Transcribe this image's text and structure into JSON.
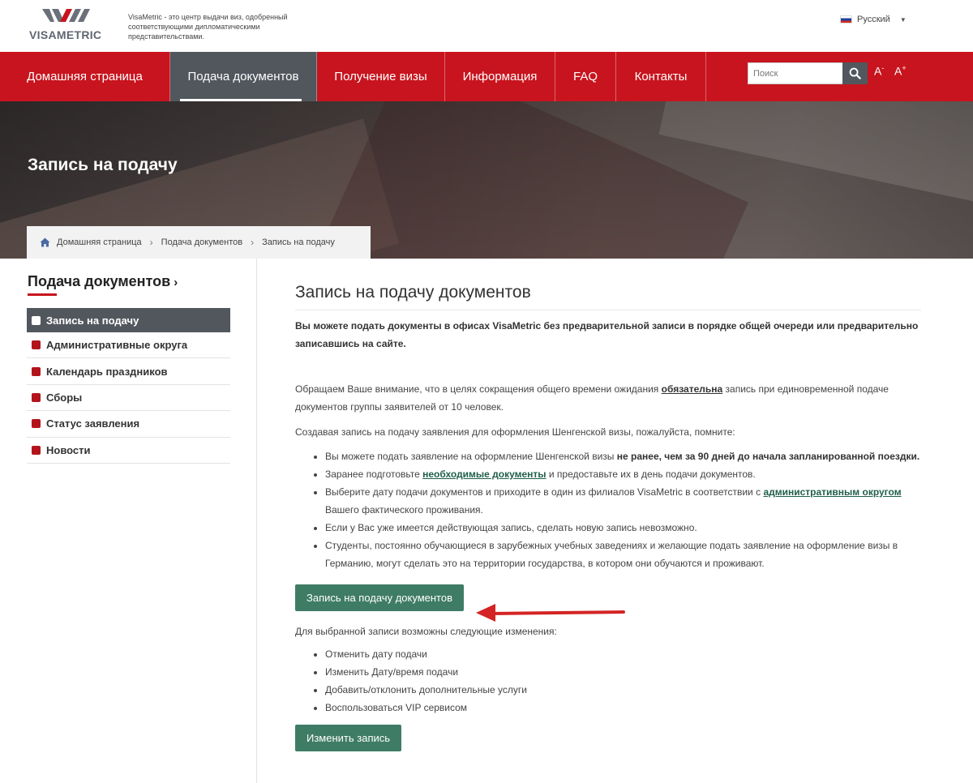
{
  "header": {
    "logo_text": "VISAMETRIC",
    "tagline": "VisaMetric - это центр выдачи виз, одобренный соответствующими дипломатическими представительствами.",
    "language": "Русский",
    "brand_color": "#c8141e"
  },
  "nav": {
    "items": [
      {
        "label": "Домашняя страница",
        "active": false
      },
      {
        "label": "Подача документов",
        "active": true
      },
      {
        "label": "Получение визы",
        "active": false
      },
      {
        "label": "Информация",
        "active": false
      },
      {
        "label": "FAQ",
        "active": false
      },
      {
        "label": "Контакты",
        "active": false
      }
    ],
    "search_placeholder": "Поиск",
    "font_decrease": "A",
    "font_decrease_sign": "-",
    "font_increase": "A",
    "font_increase_sign": "+"
  },
  "hero": {
    "title": "Запись на подачу",
    "breadcrumb": [
      "Домашняя страница",
      "Подача документов",
      "Запись на подачу"
    ]
  },
  "sidebar": {
    "title": "Подача документов",
    "title_chevron": "›",
    "items": [
      {
        "label": "Запись на подачу",
        "active": true
      },
      {
        "label": "Административные округа",
        "active": false
      },
      {
        "label": "Календарь праздников",
        "active": false
      },
      {
        "label": "Сборы",
        "active": false
      },
      {
        "label": "Статус заявления",
        "active": false
      },
      {
        "label": "Новости",
        "active": false
      }
    ]
  },
  "main": {
    "title": "Запись на подачу документов",
    "lead": "Вы можете подать документы в офисах VisaMetric без предварительной записи в порядке общей очереди или предварительно записавшись на сайте.",
    "p1": {
      "before": "Обращаем Ваше внимание, что в целях сокращения общего времени ожидания ",
      "bold": "обязательна",
      "after": " запись при единовременной подаче документов группы заявителей от 10 человек."
    },
    "p2": "Создавая запись на подачу заявления для оформления Шенгенской визы, пожалуйста, помните:",
    "bullets": {
      "b1_text": "Вы можете подать заявление на оформление Шенгенской визы ",
      "b1_bold": "не ранее, чем за 90 дней до начала запланированной поездки.",
      "b2_before": "Заранее подготовьте ",
      "b2_link": "необходимые документы",
      "b2_after": " и предоставьте их в день подачи документов.",
      "b3_before": "Выберите дату подачи документов и приходите в один из филиалов VisaMetric в соответствии с ",
      "b3_link": "административным округом",
      "b3_after": " Вашего фактического проживания.",
      "b4": "Если у Вас уже имеется действующая запись, сделать новую запись невозможно.",
      "b5": "Студенты, постоянно обучающиеся в зарубежных учебных заведениях и желающие подать заявление на оформление визы в Германию, могут сделать это на территории государства, в котором они обучаются и проживают."
    },
    "book_button": "Запись на подачу документов",
    "changes_intro": "Для выбранной записи возможны следующие изменения:",
    "changes": [
      "Отменить дату подачи",
      "Изменить Дату/время подачи",
      "Добавить/отклонить дополнительные услуги",
      "Воспользоваться VIP сервисом"
    ],
    "change_button": "Изменить запись",
    "button_color": "#3f7c66",
    "link_color": "#1f5f4a"
  },
  "annotation": {
    "arrow_color": "#d42424"
  }
}
